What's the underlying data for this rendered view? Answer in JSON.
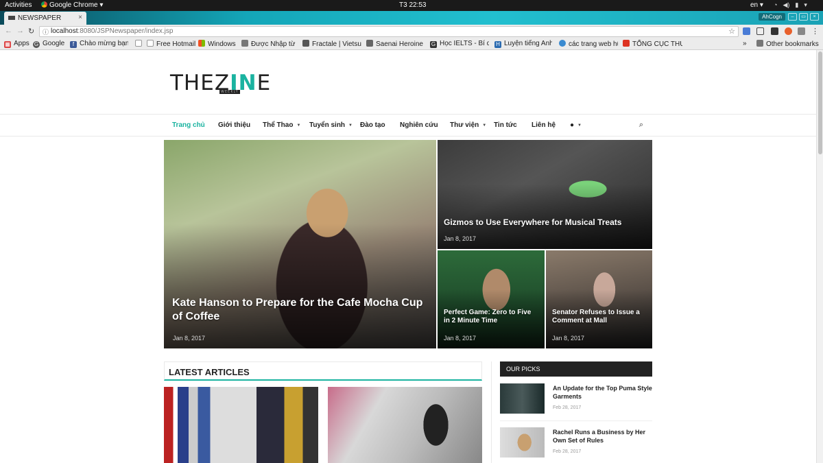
{
  "system": {
    "activities": "Activities",
    "app_name": "Google Chrome",
    "clock": "T3 22:53",
    "lang": "en"
  },
  "browser": {
    "tab_title": "NEWSPAPER",
    "incognito_label": "AhCogn",
    "url_host": "localhost",
    "url_path": ":8080/JSPNewspaper/index.jsp",
    "bookmarks": [
      {
        "label": "Apps",
        "icon": "apps-icon"
      },
      {
        "label": "Google",
        "icon": "google-icon"
      },
      {
        "label": "Chào mừng bạn",
        "icon": "facebook-icon"
      },
      {
        "label": "",
        "icon": "page-icon"
      },
      {
        "label": "Free Hotmail",
        "icon": "page-icon"
      },
      {
        "label": "Windows",
        "icon": "windows-icon"
      },
      {
        "label": "Được Nhập từ IE",
        "icon": "folder-icon"
      },
      {
        "label": "Fractale | Vietsu",
        "icon": "bookmark-icon"
      },
      {
        "label": "Saenai Heroine",
        "icon": "bookmark-icon"
      },
      {
        "label": "Học IELTS - Bí q",
        "icon": "bookmark-icon"
      },
      {
        "label": "Luyện tiếng Anh",
        "icon": "bookmark-icon"
      },
      {
        "label": "các trang web hữ",
        "icon": "globe-icon"
      },
      {
        "label": "TỔNG CỤC THUẾ",
        "icon": "bookmark-icon"
      }
    ],
    "bookmarks_overflow": "»",
    "other_bookmarks": "Other bookmarks"
  },
  "site": {
    "logo_part1": "THE",
    "logo_part2": "Z",
    "logo_in": "IN",
    "logo_part3": "E",
    "logo_weekly": "WEEKLY",
    "nav": [
      {
        "label": "Trang chủ",
        "active": true
      },
      {
        "label": "Giới thiệu"
      },
      {
        "label": "Thể Thao",
        "dropdown": true
      },
      {
        "label": "Tuyển sinh",
        "dropdown": true
      },
      {
        "label": "Đào tạo"
      },
      {
        "label": "Nghiên cứu"
      },
      {
        "label": "Thư viện",
        "dropdown": true
      },
      {
        "label": "Tin tức"
      },
      {
        "label": "Liên hệ"
      }
    ],
    "accent": "#1ab3a0"
  },
  "featured": [
    {
      "title": "Kate Hanson to Prepare for the Cafe Mocha Cup of Coffee",
      "date": "Jan 8, 2017"
    },
    {
      "title": "Gizmos to Use Everywhere for Musical Treats",
      "date": "Jan 8, 2017"
    },
    {
      "title": "Perfect Game: Zero to Five in 2 Minute Time",
      "date": "Jan 8, 2017"
    },
    {
      "title": "Senator Refuses to Issue a Comment at Mall",
      "date": "Jan 8, 2017"
    }
  ],
  "latest": {
    "heading": "LATEST ARTICLES"
  },
  "sidebar": {
    "heading": "OUR PICKS",
    "items": [
      {
        "title": "An Update for the Top Puma Style Garments",
        "date": "Feb 28, 2017"
      },
      {
        "title": "Rachel Runs a Business by Her Own Set of Rules",
        "date": "Feb 28, 2017"
      }
    ]
  }
}
